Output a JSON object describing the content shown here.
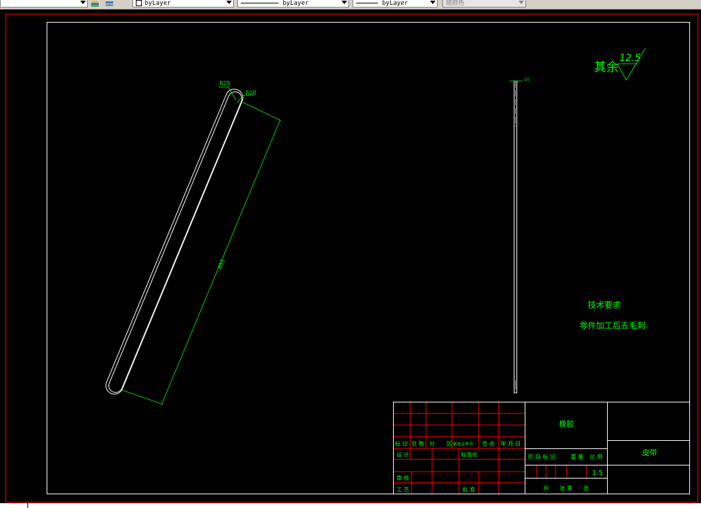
{
  "toolbar": {
    "layer_color_value": "byLayer",
    "linetype_value": "byLayer",
    "lineweight_value": "byLayer",
    "plotstyle_value": "随颜色"
  },
  "drawing": {
    "roughness_label": "其余",
    "roughness_value": "12.5",
    "dims": {
      "r25": "R25",
      "r20": "R20",
      "length": "851",
      "thickness": "10"
    },
    "tech_title": "技术要求",
    "tech_note": "零件加工后去毛刺."
  },
  "title_block": {
    "rev_headers": [
      "标 记",
      "处 数",
      "分",
      "区",
      "更改文件号",
      "签 名",
      "年 月 日"
    ],
    "row_design": "设 计",
    "row_standard": "标准化",
    "row_review": "审 核",
    "row_process": "工 艺",
    "row_approve": "批 准",
    "material": "橡胶",
    "stage_headers": [
      "阶 段 标 记",
      "重 量",
      "比 例"
    ],
    "scale": "1:5",
    "sheets": "共　　张 第　　张",
    "part_name": "皮带"
  },
  "colors": {
    "outline": "#ffffff",
    "dimension": "#00ff00",
    "border": "#ff0000",
    "grid": "#ff0000"
  }
}
